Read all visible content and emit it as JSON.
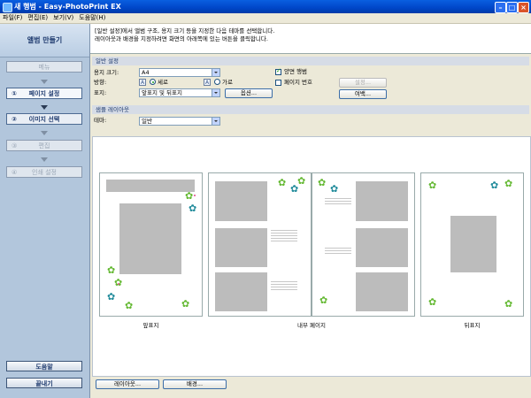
{
  "window": {
    "title": "새 행범 - Easy-PhotoPrint EX"
  },
  "menu": [
    "파일(F)",
    "편집(E)",
    "보기(V)",
    "도움말(H)"
  ],
  "sidebar": {
    "title": "앨범 만들기",
    "steps": [
      {
        "num": "",
        "label": "메뉴"
      },
      {
        "num": "①",
        "label": "페이지 설정"
      },
      {
        "num": "②",
        "label": "이미지 선택"
      },
      {
        "num": "③",
        "label": "편집"
      },
      {
        "num": "④",
        "label": "인쇄 설정"
      }
    ],
    "help": "도움말",
    "exit": "끝내기"
  },
  "instructions": {
    "line1": "[일반 설정]에서 앨범 구조, 용지 크기 등을 지정한 다음 테마를 선택합니다.",
    "line2": "레이아웃과 배경을 지정하려면 화면의 아래쪽에 있는 버튼을 클릭합니다."
  },
  "general": {
    "header": "일반 설정",
    "paper_label": "용지 크기:",
    "paper_value": "A4",
    "orient_label": "방향:",
    "portrait": "세로",
    "landscape": "가로",
    "cover_label": "표지:",
    "cover_value": "앞표지 및 뒤표지",
    "options_btn": "옵션...",
    "duplex": "양면 행범",
    "page_number": "페이지 번호",
    "settings_btn": "설정...",
    "margin_btn": "여백..."
  },
  "sample": {
    "header": "샘플 레이아웃",
    "theme_label": "테마:",
    "theme_value": "일반"
  },
  "preview": {
    "front": "앞표지",
    "inner": "내부 페이지",
    "back": "뒤표지"
  },
  "bottom": {
    "layout_btn": "레이아웃...",
    "bg_btn": "배경..."
  },
  "colors": {
    "title_bar": "#0052d6",
    "sidebar": "#b2c6dc",
    "flower_green": "#63b831",
    "flower_teal": "#1f8a9a"
  }
}
